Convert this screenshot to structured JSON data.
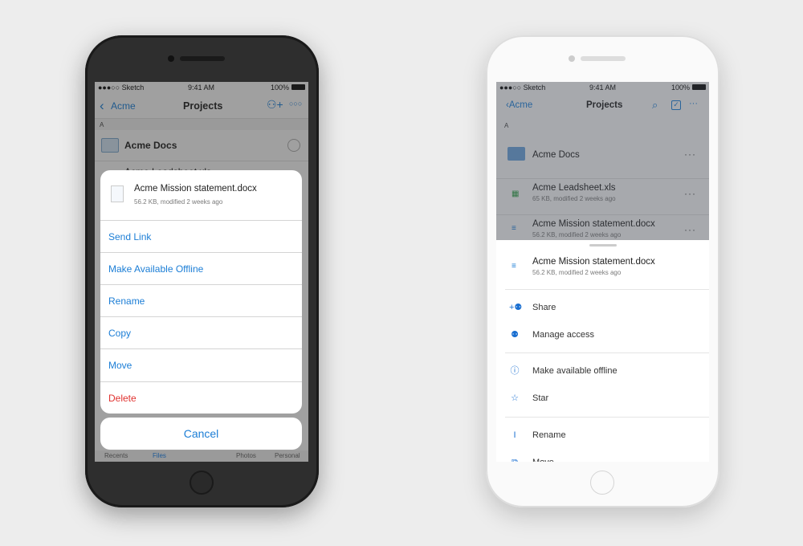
{
  "status": {
    "carrier": "●●●○○ Sketch",
    "time": "9:41 AM",
    "battery": "100%"
  },
  "nav": {
    "back": "Acme",
    "title": "Projects"
  },
  "section": "A",
  "files": [
    {
      "name": "Acme Docs",
      "meta": ""
    },
    {
      "name": "Acme Leadsheet.xls",
      "meta": "65 KB, modified 2 weeks ago"
    },
    {
      "name": "Acme Mission statement.docx",
      "meta": "56.2 KB, modified 2 weeks ago"
    }
  ],
  "ios_sheet": {
    "file": "Acme Mission statement.docx",
    "meta": "56.2 KB, modified 2 weeks ago",
    "actions": [
      "Send Link",
      "Make Available Offline",
      "Rename",
      "Copy",
      "Move",
      "Delete"
    ],
    "cancel": "Cancel"
  },
  "tabbar": [
    "Recents",
    "Files",
    "Photos",
    "Personal"
  ],
  "md_sheet": {
    "file": "Acme Mission statement.docx",
    "meta": "56.2 KB, modified 2 weeks ago",
    "actions": [
      {
        "label": "Share",
        "icon": "add-person-icon"
      },
      {
        "label": "Manage access",
        "icon": "people-icon"
      },
      {
        "label": "Make available offline",
        "icon": "offline-download-icon"
      },
      {
        "label": "Star",
        "icon": "star-icon"
      },
      {
        "label": "Rename",
        "icon": "text-cursor-icon"
      },
      {
        "label": "Move",
        "icon": "move-icon"
      }
    ]
  },
  "colors": {
    "accent": "#1c7ed6",
    "danger": "#e0322f"
  }
}
